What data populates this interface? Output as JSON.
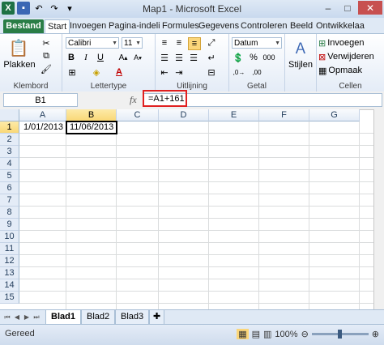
{
  "window": {
    "title": "Map1  -  Microsoft Excel",
    "app_icon": "X"
  },
  "tabs": [
    "Bestand",
    "Start",
    "Invoegen",
    "Pagina-indeli",
    "Formules",
    "Gegevens",
    "Controleren",
    "Beeld",
    "Ontwikkelaa"
  ],
  "ribbon": {
    "clipboard": {
      "paste_label": "Plakken",
      "group_label": "Klembord"
    },
    "font": {
      "name": "Calibri",
      "size": "11",
      "group_label": "Lettertype"
    },
    "alignment": {
      "group_label": "Uitlijning"
    },
    "number": {
      "format": "Datum",
      "group_label": "Getal"
    },
    "styles": {
      "label": "Stijlen"
    },
    "cells": {
      "insert": "Invoegen",
      "delete": "Verwijderen",
      "format": "Opmaak",
      "group_label": "Cellen"
    }
  },
  "formula_bar": {
    "name_box": "B1",
    "fx": "fx",
    "formula": "=A1+161"
  },
  "grid": {
    "columns": [
      "A",
      "B",
      "C",
      "D",
      "E",
      "F",
      "G"
    ],
    "rows": [
      "1",
      "2",
      "3",
      "4",
      "5",
      "6",
      "7",
      "8",
      "9",
      "10",
      "11",
      "12",
      "13",
      "14",
      "15"
    ],
    "cells": {
      "A1": "1/01/2013",
      "B1": "11/06/2013"
    },
    "active_cell": "B1"
  },
  "sheets": [
    "Blad1",
    "Blad2",
    "Blad3"
  ],
  "status": {
    "text": "Gereed",
    "zoom": "100%"
  },
  "colors": {
    "file_tab": "#2a7d46",
    "highlight_border": "#e02020",
    "header_selected": "#f9d877"
  }
}
